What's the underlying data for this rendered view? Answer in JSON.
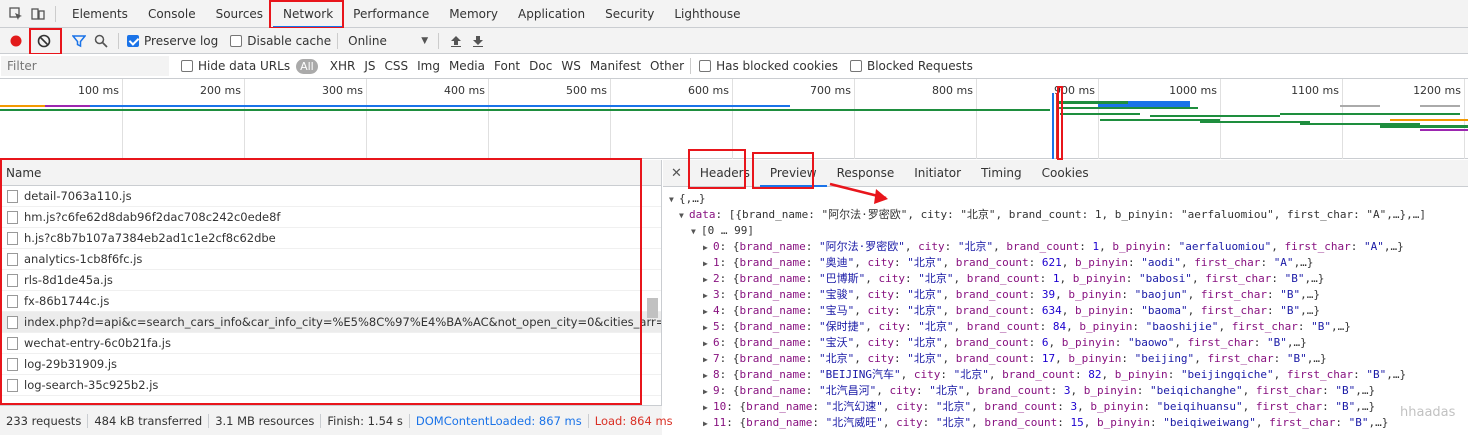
{
  "devtools_tabs": [
    "Elements",
    "Console",
    "Sources",
    "Network",
    "Performance",
    "Memory",
    "Application",
    "Security",
    "Lighthouse"
  ],
  "active_tab": "Network",
  "toolbar": {
    "preserve_log": "Preserve log",
    "disable_cache": "Disable cache",
    "throttle": "Online"
  },
  "filter": {
    "placeholder": "Filter",
    "hide_data_urls": "Hide data URLs",
    "types": [
      "All",
      "XHR",
      "JS",
      "CSS",
      "Img",
      "Media",
      "Font",
      "Doc",
      "WS",
      "Manifest",
      "Other"
    ],
    "has_blocked_cookies": "Has blocked cookies",
    "blocked_requests": "Blocked Requests"
  },
  "timeline_ticks": [
    "100 ms",
    "200 ms",
    "300 ms",
    "400 ms",
    "500 ms",
    "600 ms",
    "700 ms",
    "800 ms",
    "900 ms",
    "1000 ms",
    "1100 ms",
    "1200 ms"
  ],
  "request_list": {
    "header": "Name",
    "rows": [
      "detail-7063a110.js",
      "hm.js?c6fe62d8dab96f2dac708c242c0ede8f",
      "h.js?c8b7b107a7384eb2ad1c1e2cf8c62dbe",
      "analytics-1cb8f6fc.js",
      "rls-8d1de45a.js",
      "fx-86b1744c.js",
      "index.php?d=api&c=search_cars_info&car_info_city=%E5%8C%97%E4%BA%AC&not_open_city=0&cities_arr=",
      "wechat-entry-6c0b21fa.js",
      "log-29b31909.js",
      "log-search-35c925b2.js"
    ],
    "selected_index": 6
  },
  "status": {
    "requests": "233 requests",
    "transferred": "484 kB transferred",
    "resources": "3.1 MB resources",
    "finish": "Finish: 1.54 s",
    "dom_loaded": "DOMContentLoaded: 867 ms",
    "load": "Load: 864 ms"
  },
  "detail_tabs": [
    "Headers",
    "Preview",
    "Response",
    "Initiator",
    "Timing",
    "Cookies"
  ],
  "active_detail_tab": "Preview",
  "preview": {
    "root": "{,…}",
    "data_line": "[{brand_name: \"阿尔法·罗密欧\", city: \"北京\", brand_count: 1, b_pinyin: \"aerfaluomiou\", first_char: \"A\",…},…]",
    "range": "[0 … 99]",
    "items": [
      {
        "i": "0",
        "brand_name": "阿尔法·罗密欧",
        "city": "北京",
        "brand_count": "1",
        "b_pinyin": "aerfaluomiou",
        "first_char": "A"
      },
      {
        "i": "1",
        "brand_name": "奥迪",
        "city": "北京",
        "brand_count": "621",
        "b_pinyin": "aodi",
        "first_char": "A"
      },
      {
        "i": "2",
        "brand_name": "巴博斯",
        "city": "北京",
        "brand_count": "1",
        "b_pinyin": "babosi",
        "first_char": "B"
      },
      {
        "i": "3",
        "brand_name": "宝骏",
        "city": "北京",
        "brand_count": "39",
        "b_pinyin": "baojun",
        "first_char": "B"
      },
      {
        "i": "4",
        "brand_name": "宝马",
        "city": "北京",
        "brand_count": "634",
        "b_pinyin": "baoma",
        "first_char": "B"
      },
      {
        "i": "5",
        "brand_name": "保时捷",
        "city": "北京",
        "brand_count": "84",
        "b_pinyin": "baoshijie",
        "first_char": "B"
      },
      {
        "i": "6",
        "brand_name": "宝沃",
        "city": "北京",
        "brand_count": "6",
        "b_pinyin": "baowo",
        "first_char": "B"
      },
      {
        "i": "7",
        "brand_name": "北京",
        "city": "北京",
        "brand_count": "17",
        "b_pinyin": "beijing",
        "first_char": "B"
      },
      {
        "i": "8",
        "brand_name": "BEIJING汽车",
        "city": "北京",
        "brand_count": "82",
        "b_pinyin": "beijingqiche",
        "first_char": "B"
      },
      {
        "i": "9",
        "brand_name": "北汽昌河",
        "city": "北京",
        "brand_count": "3",
        "b_pinyin": "beiqichanghe",
        "first_char": "B"
      },
      {
        "i": "10",
        "brand_name": "北汽幻速",
        "city": "北京",
        "brand_count": "3",
        "b_pinyin": "beiqihuansu",
        "first_char": "B"
      },
      {
        "i": "11",
        "brand_name": "北汽威旺",
        "city": "北京",
        "brand_count": "15",
        "b_pinyin": "beiqiweiwang",
        "first_char": "B"
      }
    ]
  },
  "watermark": "hhaadas"
}
